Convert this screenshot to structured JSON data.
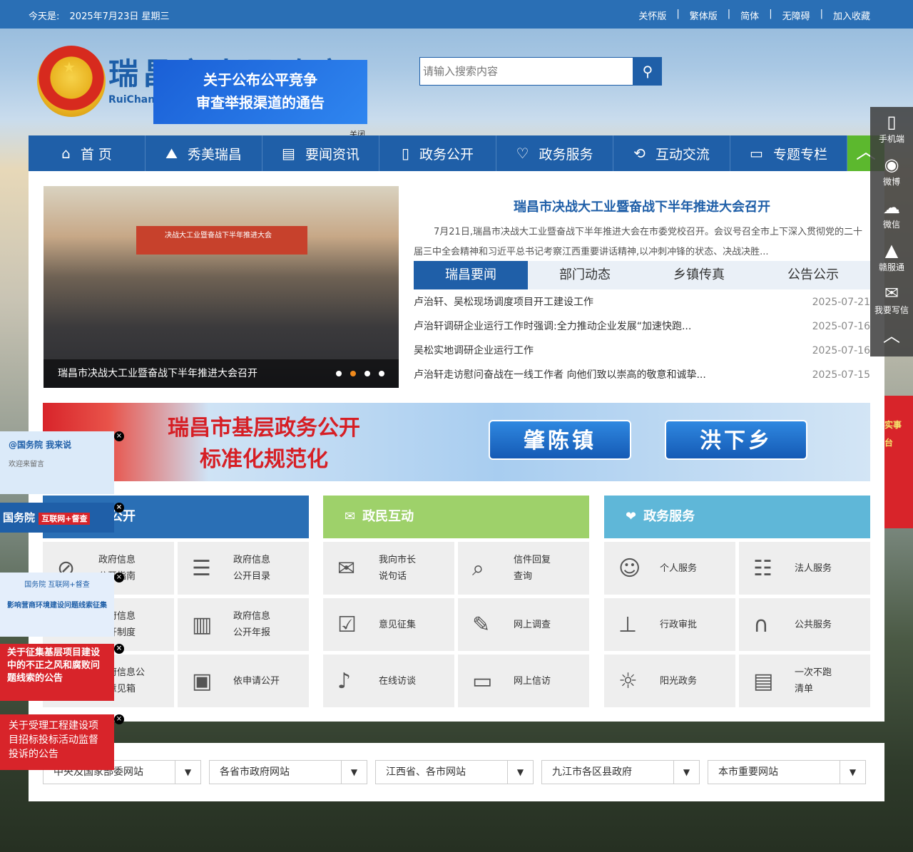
{
  "topbar": {
    "date_prefix": "今天是:",
    "date": "2025年7月23日 星期三",
    "links": [
      "关怀版",
      "繁体版",
      "简体",
      "无障碍",
      "加入收藏"
    ]
  },
  "header": {
    "site_name": "瑞昌市人民政府",
    "site_name_en": "RuiChang",
    "notice_popup": {
      "line1": "关于公布公平竞争",
      "line2": "审查举报渠道的通告",
      "close": "关闭"
    }
  },
  "search": {
    "placeholder": "请输入搜索内容",
    "icon": "search-icon"
  },
  "nav": [
    {
      "label": "首 页",
      "icon": "home-icon"
    },
    {
      "label": "秀美瑞昌",
      "icon": "mountain-icon"
    },
    {
      "label": "要闻资讯",
      "icon": "document-icon"
    },
    {
      "label": "政务公开",
      "icon": "book-icon"
    },
    {
      "label": "政务服务",
      "icon": "heart-icon"
    },
    {
      "label": "互动交流",
      "icon": "interaction-icon"
    },
    {
      "label": "专题专栏",
      "icon": "briefcase-icon"
    }
  ],
  "slider": {
    "caption": "瑞昌市决战大工业暨奋战下半年推进大会召开",
    "stage_banner": "决战大工业暨奋战下半年推进大会",
    "active_dot": 2
  },
  "headline": {
    "title": "瑞昌市决战大工业暨奋战下半年推进大会召开",
    "summary": "7月21日,瑞昌市决战大工业暨奋战下半年推进大会在市委党校召开。会议号召全市上下深入贯彻党的二十届三中全会精神和习近平总书记考察江西重要讲话精神,以冲刺冲锋的状态、决战决胜..."
  },
  "tabs": [
    "瑞昌要闻",
    "部门动态",
    "乡镇传真",
    "公告公示"
  ],
  "news": [
    {
      "title": "卢治轩、吴松现场调度项目开工建设工作",
      "date": "2025-07-21"
    },
    {
      "title": "卢治轩调研企业运行工作时强调:全力推动企业发展“加速快跑...",
      "date": "2025-07-16"
    },
    {
      "title": "吴松实地调研企业运行工作",
      "date": "2025-07-16"
    },
    {
      "title": "卢治轩走访慰问奋战在一线工作者 向他们致以崇高的敬意和诚挚...",
      "date": "2025-07-15"
    }
  ],
  "banner2": {
    "title_line1": "瑞昌市基层政务公开",
    "title_line2": "标准化规范化",
    "towns": [
      "肇陈镇",
      "洪下乡"
    ]
  },
  "columns": [
    {
      "title": "信息公开",
      "color": "#2a6fb5",
      "icon": "info-icon",
      "cells": [
        {
          "l1": "政府信息",
          "l2": "公开指南",
          "icon": "compass-icon"
        },
        {
          "l1": "政府信息",
          "l2": "公开目录",
          "icon": "list-icon"
        },
        {
          "l1": "政府信息",
          "l2": "公开制度",
          "icon": "rules-icon"
        },
        {
          "l1": "政府信息",
          "l2": "公开年报",
          "icon": "report-icon"
        },
        {
          "l1": "政府信息公",
          "l2": "开意见箱",
          "icon": "mailbox-icon"
        },
        {
          "l1": "依申请公开",
          "l2": "",
          "icon": "archive-icon"
        }
      ]
    },
    {
      "title": "政民互动",
      "color": "#9ed16a",
      "icon": "mail-icon",
      "cells": [
        {
          "l1": "我向市长",
          "l2": "说句话",
          "icon": "envelope-icon"
        },
        {
          "l1": "信件回复",
          "l2": "查询",
          "icon": "search-doc-icon"
        },
        {
          "l1": "意见征集",
          "l2": "",
          "icon": "checklist-icon"
        },
        {
          "l1": "网上调查",
          "l2": "",
          "icon": "edit-icon"
        },
        {
          "l1": "在线访谈",
          "l2": "",
          "icon": "microphone-icon"
        },
        {
          "l1": "网上信访",
          "l2": "",
          "icon": "chat-icon"
        }
      ]
    },
    {
      "title": "政务服务",
      "color": "#5fb7d8",
      "icon": "heart-icon",
      "cells": [
        {
          "l1": "个人服务",
          "l2": "",
          "icon": "person-icon"
        },
        {
          "l1": "法人服务",
          "l2": "",
          "icon": "corporate-icon"
        },
        {
          "l1": "行政审批",
          "l2": "",
          "icon": "stamp-icon"
        },
        {
          "l1": "公共服务",
          "l2": "",
          "icon": "headset-icon"
        },
        {
          "l1": "阳光政务",
          "l2": "",
          "icon": "sun-icon"
        },
        {
          "l1": "一次不跑",
          "l2": "清单",
          "icon": "checklist-icon"
        }
      ]
    }
  ],
  "link_selects": [
    "中央及国家部委网站",
    "各省市政府网站",
    "江西省、各市网站",
    "九江市各区县政府",
    "本市重要网站"
  ],
  "floatbar": [
    {
      "label": "手机端",
      "icon": "phone-icon"
    },
    {
      "label": "微博",
      "icon": "weibo-icon"
    },
    {
      "label": "微信",
      "icon": "wechat-icon"
    },
    {
      "label": "赣服通",
      "icon": "gfl-icon"
    },
    {
      "label": "我要写信",
      "icon": "envelope-icon"
    },
    {
      "label": "",
      "icon": "back-to-top-icon"
    }
  ],
  "left_floats": [
    {
      "line1": "@国务院 我来说",
      "line2": "欢迎来留言"
    },
    {
      "line1": "国务院",
      "line2": "互联网+督查"
    },
    {
      "line1": "国务院 互联网+督查",
      "line2": "影响营商环境建设问题线索征集"
    },
    {
      "line1": "关于征集基层项目建设中的不正之风和腐败问题线索的公告",
      "line2": ""
    },
    {
      "line1": "关于受理工程建设项目招标投标活动监督投诉的公告",
      "line2": ""
    }
  ],
  "right_side_banner": {
    "l1": "实事",
    "l2": "台"
  }
}
